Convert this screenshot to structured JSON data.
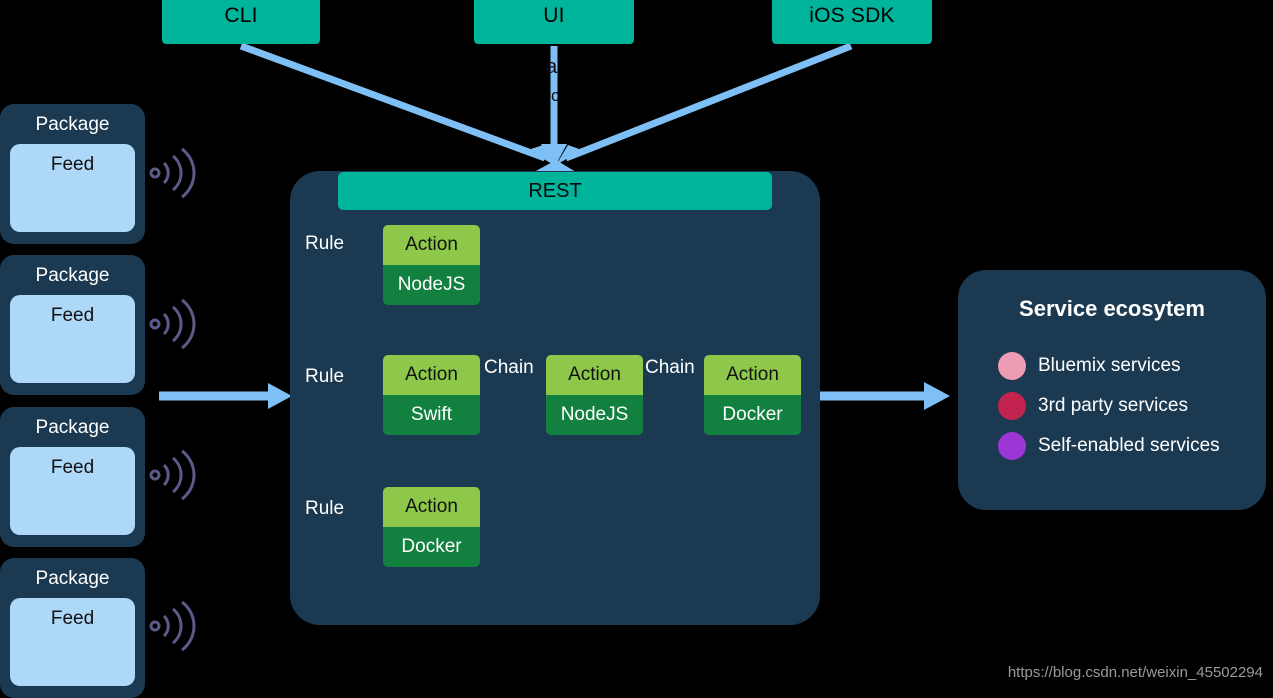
{
  "clients": [
    {
      "name": "cli",
      "label": "CLI"
    },
    {
      "name": "ui",
      "label": "UI"
    },
    {
      "name": "ios_sdk",
      "label": "iOS SDK"
    }
  ],
  "obscured_text": {
    "fragment_1": "a",
    "fragment_2": "c"
  },
  "packages": [
    {
      "title": "Package",
      "feed": "Feed"
    },
    {
      "title": "Package",
      "feed": "Feed"
    },
    {
      "title": "Package",
      "feed": "Feed"
    },
    {
      "title": "Package",
      "feed": "Feed"
    }
  ],
  "engine": {
    "rest_label": "REST",
    "rows": [
      {
        "rule_label": "Rule",
        "actions": [
          {
            "title": "Action",
            "runtime": "NodeJS"
          }
        ]
      },
      {
        "rule_label": "Rule",
        "chain_label_1": "Chain",
        "chain_label_2": "Chain",
        "actions": [
          {
            "title": "Action",
            "runtime": "Swift"
          },
          {
            "title": "Action",
            "runtime": "NodeJS"
          },
          {
            "title": "Action",
            "runtime": "Docker"
          }
        ]
      },
      {
        "rule_label": "Rule",
        "actions": [
          {
            "title": "Action",
            "runtime": "Docker"
          }
        ]
      }
    ]
  },
  "service_panel": {
    "title": "Service ecosytem",
    "legend": [
      {
        "label": "Bluemix services",
        "color": "#EE9CB4"
      },
      {
        "label": "3rd party services",
        "color": "#C2234F"
      },
      {
        "label": "Self-enabled services",
        "color": "#9B35D6"
      }
    ]
  },
  "watermark": "https://blog.csdn.net/weixin_45502294",
  "colors": {
    "background": "#000000",
    "panel": "#1B3A52",
    "teal": "#00B39B",
    "action_top": "#8DC84A",
    "action_bottom": "#12803F",
    "feed": "#ADD8F7",
    "arrow": "#7EC0F5",
    "signal": "#5B5B8A"
  }
}
